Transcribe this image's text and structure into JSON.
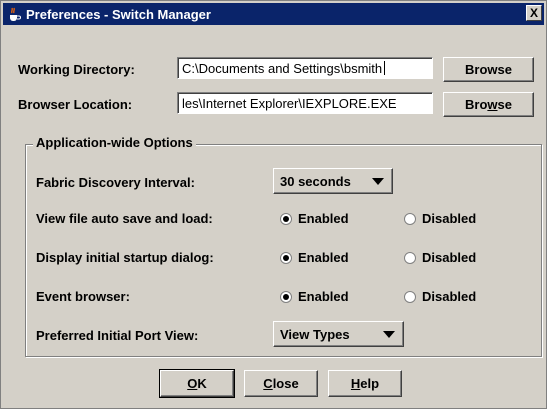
{
  "window": {
    "title": "Preferences - Switch Manager",
    "close_glyph": "X"
  },
  "fields": {
    "working_directory": {
      "label": "Working Directory:",
      "value": "C:\\Documents and Settings\\bsmith",
      "button": "Browse"
    },
    "browser_location": {
      "label": "Browser Location:",
      "value": "les\\Internet Explorer\\IEXPLORE.EXE",
      "button_pre": "Bro",
      "button_mnemonic": "w",
      "button_post": "se"
    }
  },
  "options": {
    "group_title": "Application-wide Options",
    "fabric_discovery": {
      "label": "Fabric Discovery Interval:",
      "selected": "30 seconds"
    },
    "view_file_auto_save": {
      "label": "View file auto save and load:",
      "enabled_label": "Enabled",
      "disabled_label": "Disabled",
      "selected": "Enabled"
    },
    "startup_dialog": {
      "label": "Display initial startup dialog:",
      "enabled_label": "Enabled",
      "disabled_label": "Disabled",
      "selected": "Enabled"
    },
    "event_browser": {
      "label": "Event browser:",
      "enabled_label": "Enabled",
      "disabled_label": "Disabled",
      "selected": "Enabled"
    },
    "port_view": {
      "label": "Preferred Initial Port View:",
      "selected": "View Types"
    }
  },
  "buttons": {
    "ok_mnemonic": "O",
    "ok_rest": "K",
    "close_mnemonic": "C",
    "close_rest": "lose",
    "help_mnemonic": "H",
    "help_rest": "elp"
  },
  "colors": {
    "titlebar": "#0a246a",
    "face": "#d4d0c8"
  }
}
